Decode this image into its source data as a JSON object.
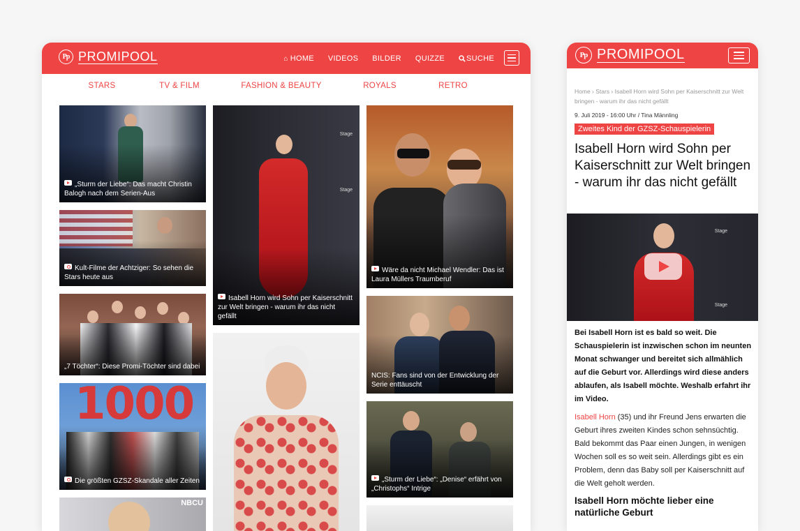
{
  "brand": {
    "logo_text": "PROMIPOOL",
    "logo_mark": "Pp",
    "accent": "#ef4444"
  },
  "desktop": {
    "topnav": {
      "home": "HOME",
      "videos": "VIDEOS",
      "bilder": "BILDER",
      "quizze": "QUIZZE",
      "suche": "SUCHE"
    },
    "categories": [
      "STARS",
      "TV & FILM",
      "FASHION & BEAUTY",
      "ROYALS",
      "RETRO"
    ],
    "cards": [
      {
        "type": "video",
        "caption": "„Sturm der Liebe“: Das macht Christin Balogh nach dem Serien-Aus"
      },
      {
        "type": "gallery",
        "caption": "Kult-Filme der Achtziger: So sehen die Stars heute aus"
      },
      {
        "type": "none",
        "caption": "„7 Töchter“: Diese Promi-Töchter sind dabei"
      },
      {
        "type": "gallery",
        "caption": "Die größten GZSZ-Skandale aller Zeiten"
      },
      {
        "type": "video",
        "caption": "Isabell Horn wird Sohn per Kaiserschnitt zur Welt bringen - warum ihr das nicht gefällt"
      },
      {
        "type": "video",
        "caption": "Wäre da nicht Michael Wendler: Das ist Laura Müllers Traumberuf"
      },
      {
        "type": "none",
        "caption": "NCIS: Fans sind von der Entwicklung der Serie enttäuscht"
      },
      {
        "type": "video",
        "caption": "„Sturm der Liebe“: „Denise“ erfährt von „Christophs“ Intrige"
      }
    ],
    "img_text": {
      "thousand": "1000",
      "stage": "Stage",
      "nbc": "NBCU"
    }
  },
  "mobile": {
    "breadcrumb": "Home › Stars › Isabell Horn wird Sohn per Kaiserschnitt zur Welt bringen - warum ihr das nicht gefällt",
    "date": "9. Juli 2019 - 16:00 Uhr / Tina Männling",
    "kicker": "Zweites Kind der GZSZ-Schauspielerin",
    "headline": "Isabell Horn wird Sohn per Kaiserschnitt zur Welt bringen - warum ihr das nicht gefällt",
    "lead": "Bei Isabell Horn ist es bald so weit. Die Schauspielerin ist inzwischen schon im neunten Monat schwanger und bereitet sich allmählich auf die Geburt vor. Allerdings wird diese anders ablaufen, als Isabell möchte. Weshalb erfahrt ihr im Video.",
    "body_link": "Isabell Horn",
    "body_text": " (35) und ihr Freund Jens erwarten die Geburt ihres zweiten Kindes schon sehnsüchtig. Bald bekommt das Paar einen Jungen, in wenigen Wochen soll es so weit sein. Allerdings gibt es ein Problem, denn das Baby soll per Kaiserschnitt auf die Welt geholt werden.",
    "subhead": "Isabell Horn möchte lieber eine natürliche Geburt"
  }
}
